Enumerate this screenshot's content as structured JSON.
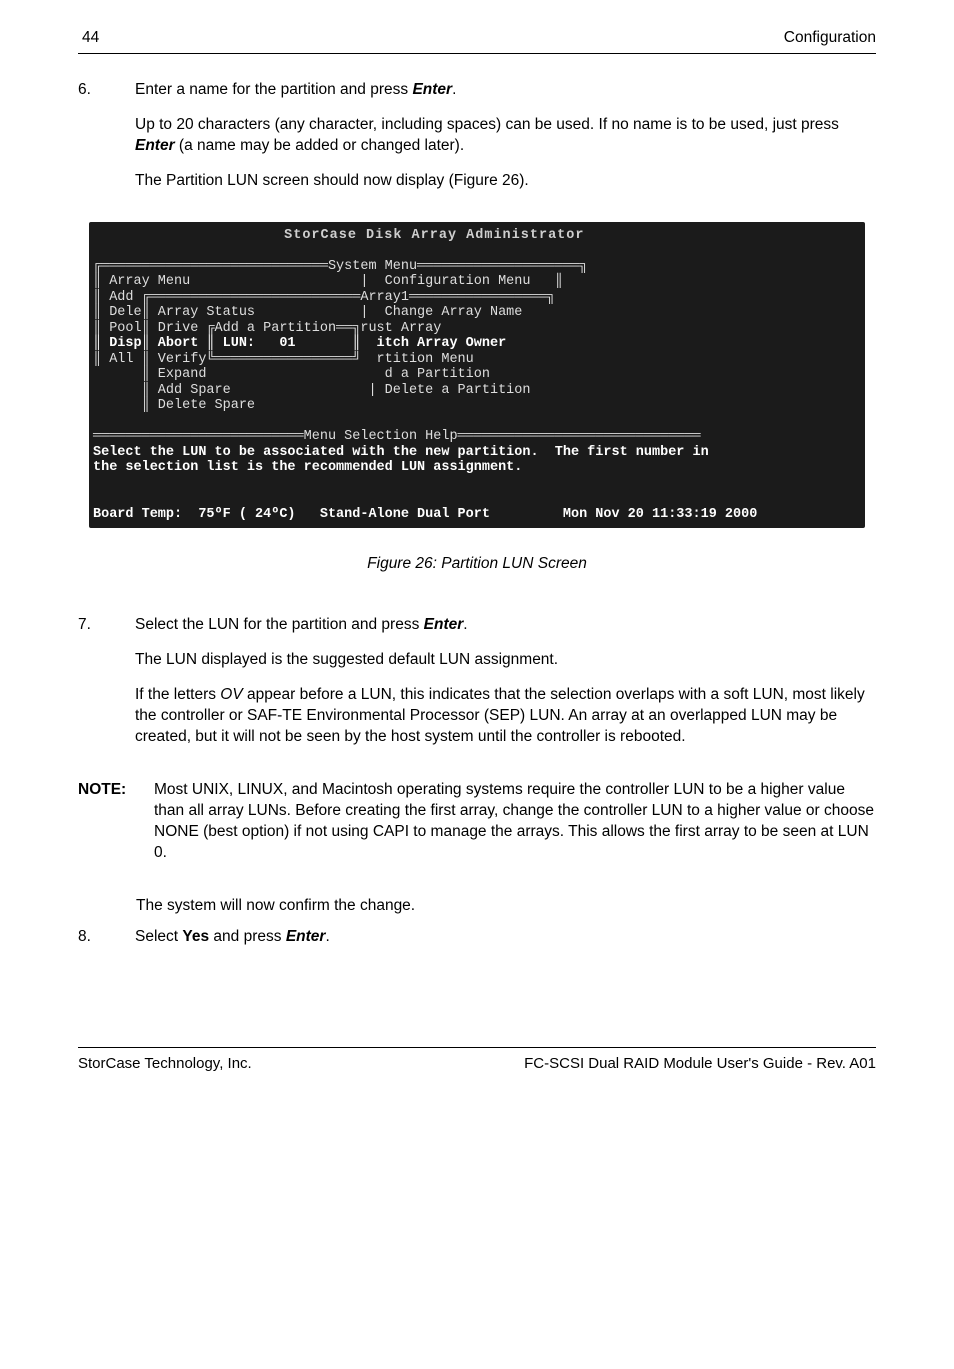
{
  "header": {
    "page_number": "44",
    "section_title": "Configuration"
  },
  "step6": {
    "num": "6.",
    "line1_a": "Enter a name for the partition and press ",
    "line1_b": "Enter",
    "line1_c": ".",
    "para2_a": "Up to 20 characters (any character, including spaces) can be used.  If no name is to be used, just press ",
    "para2_b": "Enter",
    "para2_c": " (a name may be added or changed later).",
    "para3": "The Partition LUN screen should now display (Figure 26)."
  },
  "terminal": {
    "title_line": "                     StorCase Disk Array Administrator                     ",
    "blank": "",
    "l1": "╔════════════════════════════System Menu════════════════════╗",
    "l2": "║ Array Menu                     |  Configuration Menu   ║",
    "l3": "║ Add ╔══════════════════════════Array1═════════════════╗",
    "l4": "║ Dele║ Array Status             |  Change Array Name",
    "l5": "║ Pool║ Drive ╔Add a Partition══╗rust Array",
    "l6": "║ Disp║ Abort ║ LUN:   01       ║  itch Array Owner",
    "l7": "║ All ║ Verify╚═════════════════╝  rtition Menu",
    "l8": "      ║ Expand                      d a Partition",
    "l9": "      ║ Add Spare                 | Delete a Partition",
    "l10": "      ║ Delete Spare",
    "l11": "",
    "l12": "══════════════════════════Menu Selection Help══════════════════════════════",
    "l13": "Select the LUN to be associated with the new partition.  The first number in",
    "l14": "the selection list is the recommended LUN assignment.",
    "l15": "",
    "l16": "",
    "l17": "Board Temp:  75ºF ( 24ºC)   Stand-Alone Dual Port         Mon Nov 20 11:33:19 2000"
  },
  "figure_caption": "Figure 26:   Partition LUN Screen",
  "step7": {
    "num": "7.",
    "line1_a": "Select the LUN for the partition and press ",
    "line1_b": "Enter",
    "line1_c": ".",
    "para2": "The LUN displayed is the suggested default LUN assignment.",
    "para3_a": "If the letters ",
    "para3_b": "OV",
    "para3_c": " appear before a LUN, this indicates that the selection overlaps with a soft LUN, most likely the controller or SAF-TE Environmental Processor (SEP) LUN. An array at an overlapped LUN may be created, but it will not be seen by the host system until the controller is rebooted."
  },
  "note": {
    "label": "NOTE:",
    "body": "Most UNIX, LINUX, and Macintosh operating systems require the controller LUN to be a higher value than all array LUNs.  Before creating the first array, change the controller LUN to a higher value or choose NONE (best option) if not using CAPI to manage the arrays.  This allows the first array to be seen at LUN 0."
  },
  "confirm": "The system will now confirm the change.",
  "step8": {
    "num": "8.",
    "a": "Select ",
    "b": "Yes",
    "c": " and press ",
    "d": "Enter",
    "e": "."
  },
  "footer": {
    "left": "StorCase Technology, Inc.",
    "right": "FC-SCSI Dual RAID Module User's Guide - Rev. A01"
  }
}
